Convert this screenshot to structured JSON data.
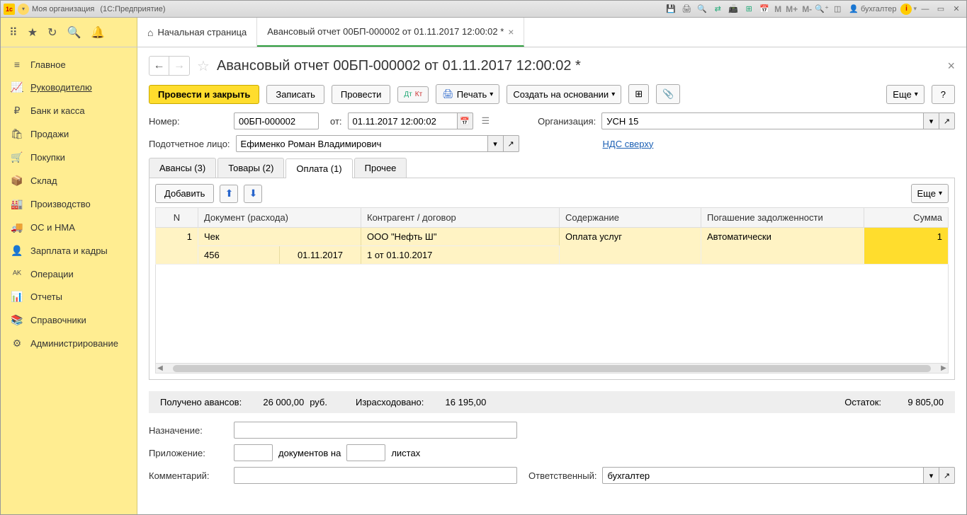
{
  "titlebar": {
    "org": "Моя организация",
    "app": "(1С:Предприятие)",
    "user": "бухгалтер",
    "m": "M",
    "mplus": "M+",
    "mminus": "M-"
  },
  "toolbar_tabs": {
    "home": "Начальная страница",
    "doc": "Авансовый отчет 00БП-000002 от 01.11.2017 12:00:02 *"
  },
  "sidebar": {
    "items": [
      {
        "icon": "≡",
        "label": "Главное"
      },
      {
        "icon": "📈",
        "label": "Руководителю"
      },
      {
        "icon": "₽",
        "label": "Банк и касса"
      },
      {
        "icon": "🛍",
        "label": "Продажи"
      },
      {
        "icon": "🛒",
        "label": "Покупки"
      },
      {
        "icon": "📦",
        "label": "Склад"
      },
      {
        "icon": "🏭",
        "label": "Производство"
      },
      {
        "icon": "🚚",
        "label": "ОС и НМА"
      },
      {
        "icon": "👤",
        "label": "Зарплата и кадры"
      },
      {
        "icon": "ᴬᴷ",
        "label": "Операции"
      },
      {
        "icon": "📊",
        "label": "Отчеты"
      },
      {
        "icon": "📚",
        "label": "Справочники"
      },
      {
        "icon": "⚙",
        "label": "Администрирование"
      }
    ]
  },
  "doc": {
    "title": "Авансовый отчет 00БП-000002 от 01.11.2017 12:00:02 *"
  },
  "cmd": {
    "post_close": "Провести и закрыть",
    "write": "Записать",
    "post": "Провести",
    "print": "Печать",
    "create_based": "Создать на основании",
    "more": "Еще",
    "help": "?"
  },
  "form": {
    "number_label": "Номер:",
    "number": "00БП-000002",
    "from_label": "от:",
    "date": "01.11.2017 12:00:02",
    "org_label": "Организация:",
    "org": "УСН 15",
    "person_label": "Подотчетное лицо:",
    "person": "Ефименко Роман Владимирович",
    "nds": "НДС сверху"
  },
  "inner_tabs": {
    "advances": "Авансы (3)",
    "goods": "Товары (2)",
    "payment": "Оплата (1)",
    "other": "Прочее"
  },
  "table_cmd": {
    "add": "Добавить",
    "more": "Еще"
  },
  "table": {
    "headers": {
      "n": "N",
      "doc": "Документ (расхода)",
      "contr": "Контрагент / договор",
      "content": "Содержание",
      "debt": "Погашение задолженности",
      "sum": "Сумма"
    },
    "rows": [
      {
        "n": "1",
        "doc_type": "Чек",
        "doc_num": "456",
        "doc_date": "01.11.2017",
        "contractor": "ООО \"Нефть Ш\"",
        "contract": "1 от 01.10.2017",
        "content": "Оплата услуг",
        "debt": "Автоматически",
        "sum": "1"
      }
    ]
  },
  "totals": {
    "received_label": "Получено авансов:",
    "received": "26 000,00",
    "currency": "руб.",
    "spent_label": "Израсходовано:",
    "spent": "16 195,00",
    "balance_label": "Остаток:",
    "balance": "9 805,00"
  },
  "footer": {
    "purpose_label": "Назначение:",
    "att_label": "Приложение:",
    "att_docs": "документов на",
    "att_sheets": "листах",
    "comment_label": "Комментарий:",
    "resp_label": "Ответственный:",
    "resp": "бухгалтер"
  }
}
